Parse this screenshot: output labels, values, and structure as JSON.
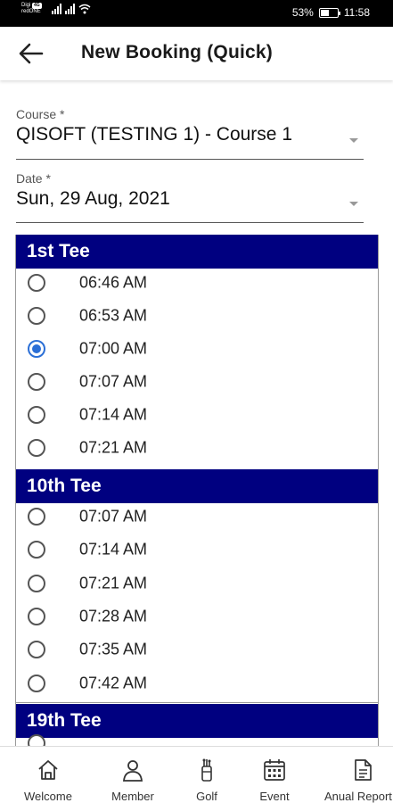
{
  "status_bar": {
    "carrier_line1": "Digi",
    "carrier_badge": "4G",
    "carrier_line2": "redONE",
    "battery_text": "53%",
    "battery_level": 0.53,
    "time": "11:58"
  },
  "app_bar": {
    "back_icon": "arrow-left-icon",
    "title": "New Booking (Quick)"
  },
  "form": {
    "course": {
      "label": "Course *",
      "value": "QISOFT (TESTING 1) - Course 1"
    },
    "date": {
      "label": "Date *",
      "value": "Sun, 29 Aug, 2021"
    }
  },
  "tees": [
    {
      "name": "1st Tee",
      "slots": [
        {
          "time": "06:46 AM",
          "selected": false
        },
        {
          "time": "06:53 AM",
          "selected": false
        },
        {
          "time": "07:00 AM",
          "selected": true
        },
        {
          "time": "07:07 AM",
          "selected": false
        },
        {
          "time": "07:14 AM",
          "selected": false
        },
        {
          "time": "07:21 AM",
          "selected": false
        }
      ]
    },
    {
      "name": "10th Tee",
      "slots": [
        {
          "time": "07:07 AM",
          "selected": false
        },
        {
          "time": "07:14 AM",
          "selected": false
        },
        {
          "time": "07:21 AM",
          "selected": false
        },
        {
          "time": "07:28 AM",
          "selected": false
        },
        {
          "time": "07:35 AM",
          "selected": false
        },
        {
          "time": "07:42 AM",
          "selected": false
        }
      ]
    },
    {
      "name": "19th Tee",
      "slots": []
    }
  ],
  "bottom_nav": [
    {
      "label": "Welcome",
      "icon": "home-icon"
    },
    {
      "label": "Member",
      "icon": "person-icon"
    },
    {
      "label": "Golf",
      "icon": "golf-bag-icon"
    },
    {
      "label": "Event",
      "icon": "calendar-icon"
    },
    {
      "label": "Anual Report",
      "icon": "document-icon"
    }
  ],
  "colors": {
    "tee_header_bg": "#000080",
    "radio_selected": "#2b6fd6"
  }
}
